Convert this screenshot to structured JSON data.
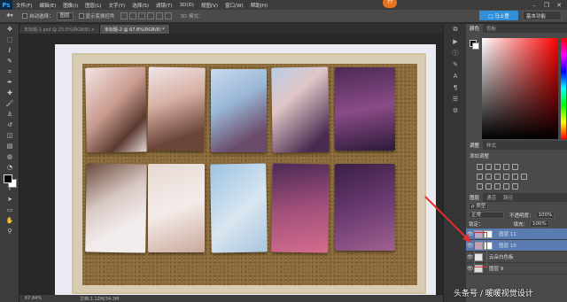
{
  "app": {
    "logo": "Ps",
    "badge": "77"
  },
  "menu": [
    "文件(F)",
    "编辑(E)",
    "图像(I)",
    "图层(L)",
    "文字(Y)",
    "选择(S)",
    "滤镜(T)",
    "3D(D)",
    "视图(V)",
    "窗口(W)",
    "帮助(H)"
  ],
  "window_controls": [
    "–",
    "❐",
    "✕"
  ],
  "options": {
    "auto_select_label": "自动选择：",
    "auto_select_value": "图层",
    "show_transform_label": "显示变换控件",
    "mode_3d": "3D 模式：",
    "workspace_button": "□ 马上登",
    "workspace_select": "基本功能"
  },
  "tabs": [
    {
      "label": "未标题-1.psd @ 23.5%(RGB/8) ×"
    },
    {
      "label": "未标题-2 @ 67.8%(RGB/8) *"
    }
  ],
  "status": {
    "zoom": "67.84%",
    "doc": "文档:1.12M/34.3M"
  },
  "panels": {
    "color_tabs": [
      "颜色",
      "色板"
    ],
    "adjust_tabs": [
      "调整",
      "样式"
    ],
    "adjust_title": "添加调整",
    "layers_tabs": [
      "图层",
      "通道",
      "路径"
    ],
    "layers_kind": "ρ 类型",
    "blend_mode": "正常",
    "opacity_label": "不透明度：",
    "opacity_value": "100%",
    "lock_label": "锁定：",
    "fill_label": "填充：",
    "fill_value": "100%",
    "layers": [
      {
        "name": "图层 11",
        "selected": true
      },
      {
        "name": "图层 10",
        "selected": true
      },
      {
        "name": "云朵白色板",
        "selected": false
      },
      {
        "name": "图层 9",
        "selected": false
      }
    ]
  },
  "watermark": "头条号 / 暖暖视觉设计",
  "colors": {
    "accent": "#2f8fd8",
    "badge": "#e8721c",
    "annotation": "#e03030",
    "selection": "#5a7cb3"
  }
}
